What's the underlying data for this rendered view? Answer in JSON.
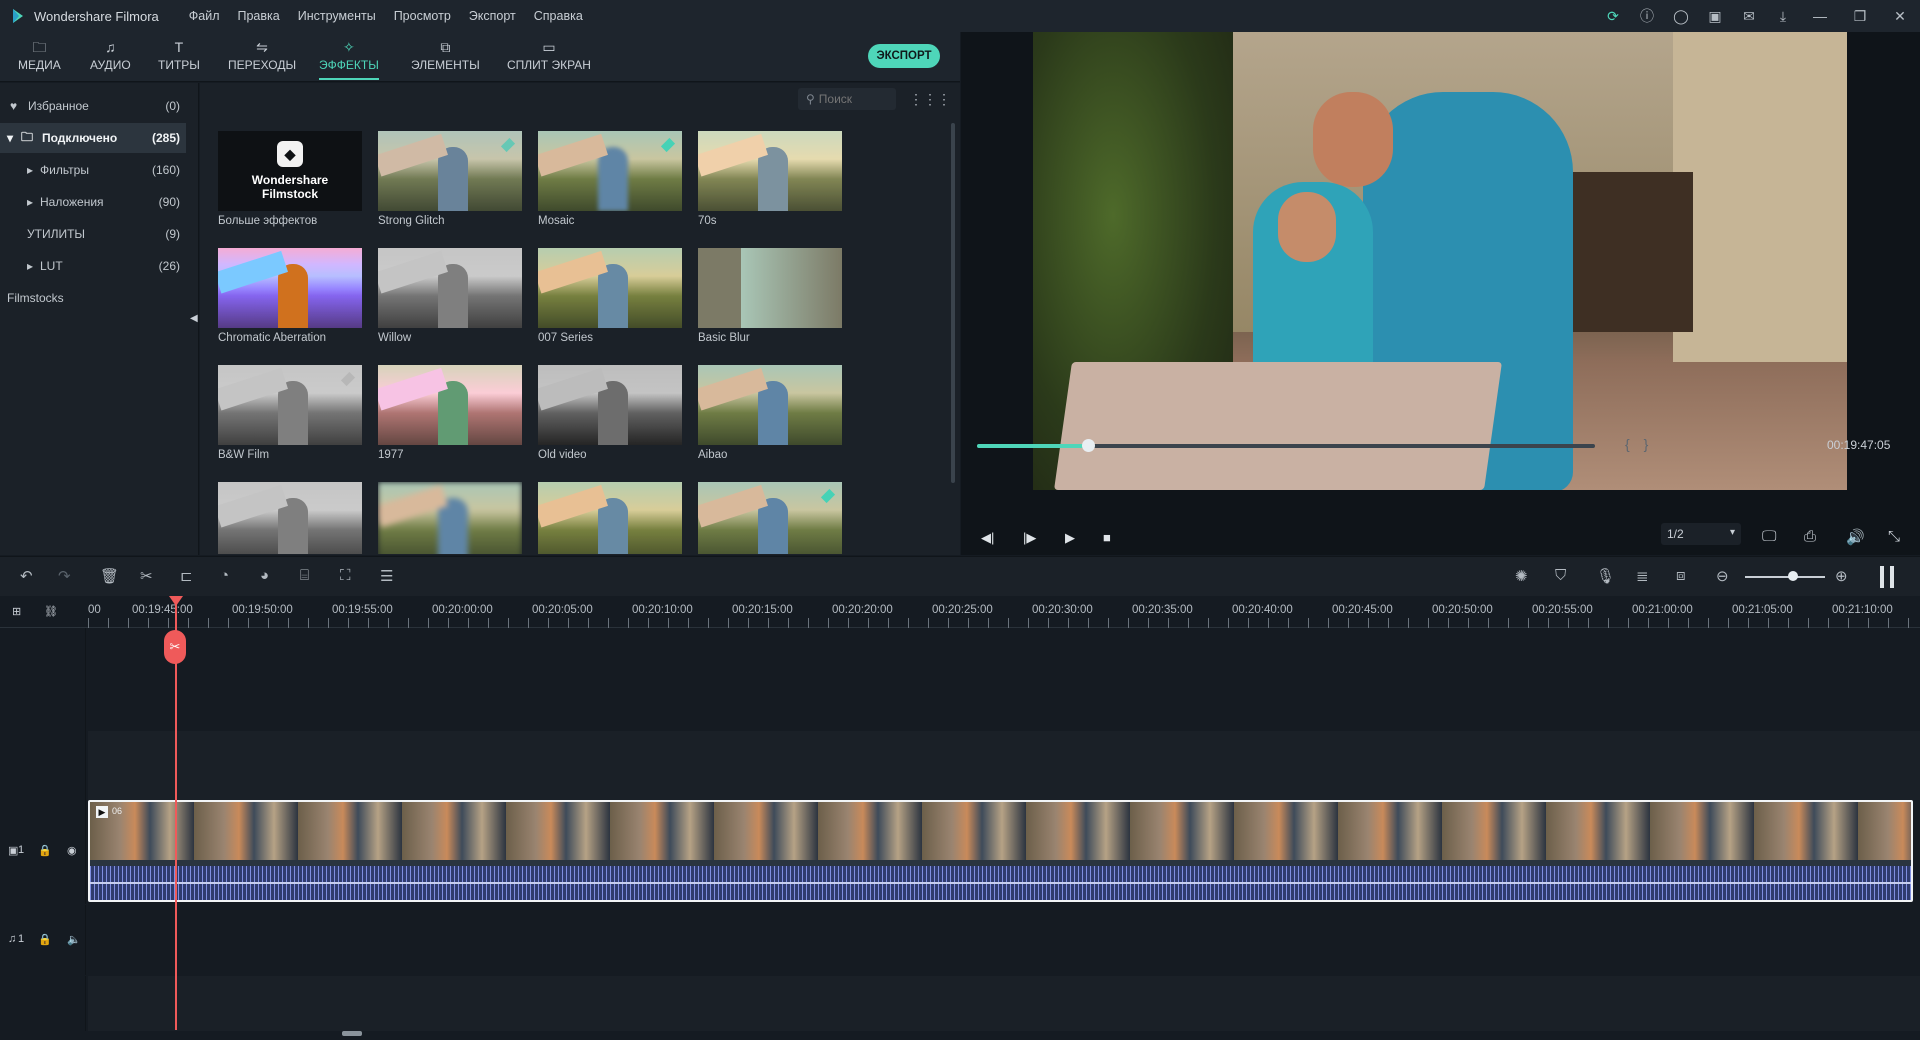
{
  "app": {
    "title": "Wondershare Filmora",
    "menu": [
      "Файл",
      "Правка",
      "Инструменты",
      "Просмотр",
      "Экспорт",
      "Справка"
    ],
    "title_icons": [
      "refresh-icon",
      "info-icon",
      "account-icon",
      "save-icon",
      "mail-icon",
      "download-icon",
      "minimize-icon",
      "restore-icon",
      "close-icon"
    ]
  },
  "tabs": [
    {
      "label": "МЕДИА",
      "icon": "folder-icon"
    },
    {
      "label": "АУДИО",
      "icon": "music-icon"
    },
    {
      "label": "ТИТРЫ",
      "icon": "text-icon"
    },
    {
      "label": "ПЕРЕХОДЫ",
      "icon": "transition-icon"
    },
    {
      "label": "ЭФФЕКТЫ",
      "icon": "effects-icon",
      "active": true
    },
    {
      "label": "ЭЛЕМЕНТЫ",
      "icon": "elements-icon"
    },
    {
      "label": "СПЛИТ ЭКРАН",
      "icon": "split-screen-icon"
    }
  ],
  "export_label": "ЭКСПОРТ",
  "sidebar": {
    "items": [
      {
        "name": "Избранное",
        "count": "(0)"
      },
      {
        "name": "Подключено",
        "count": "(285)",
        "selected": true
      },
      {
        "name": "Фильтры",
        "count": "(160)"
      },
      {
        "name": "Наложения",
        "count": "(90)"
      },
      {
        "name": "УТИЛИТЫ",
        "count": "(9)"
      },
      {
        "name": "LUT",
        "count": "(26)"
      },
      {
        "name": "Filmstocks",
        "count": ""
      }
    ]
  },
  "search": {
    "placeholder": "Поиск"
  },
  "effects": [
    {
      "name": "Больше эффектов",
      "thumb_text": "Wondershare\nFilmstock"
    },
    {
      "name": "Strong Glitch"
    },
    {
      "name": "Mosaic"
    },
    {
      "name": "70s"
    },
    {
      "name": "Chromatic Aberration"
    },
    {
      "name": "Willow"
    },
    {
      "name": "007 Series"
    },
    {
      "name": "Basic Blur"
    },
    {
      "name": "B&W Film"
    },
    {
      "name": "1977"
    },
    {
      "name": "Old video"
    },
    {
      "name": "Aibao"
    },
    {
      "name": ""
    },
    {
      "name": ""
    },
    {
      "name": ""
    },
    {
      "name": ""
    }
  ],
  "preview": {
    "timecode": "00:19:47:05",
    "progress": 0.18,
    "ratio": "1/2"
  },
  "ruler": {
    "labels": [
      "00",
      "00:19:45:00",
      "00:19:50:00",
      "00:19:55:00",
      "00:20:00:00",
      "00:20:05:00",
      "00:20:10:00",
      "00:20:15:00",
      "00:20:20:00",
      "00:20:25:00",
      "00:20:30:00",
      "00:20:35:00",
      "00:20:40:00",
      "00:20:45:00",
      "00:20:50:00",
      "00:20:55:00",
      "00:21:00:00",
      "00:21:05:00",
      "00:21:10:00"
    ]
  },
  "tracks": {
    "video_label": "1",
    "audio_label": "1",
    "clip_label": "06"
  }
}
